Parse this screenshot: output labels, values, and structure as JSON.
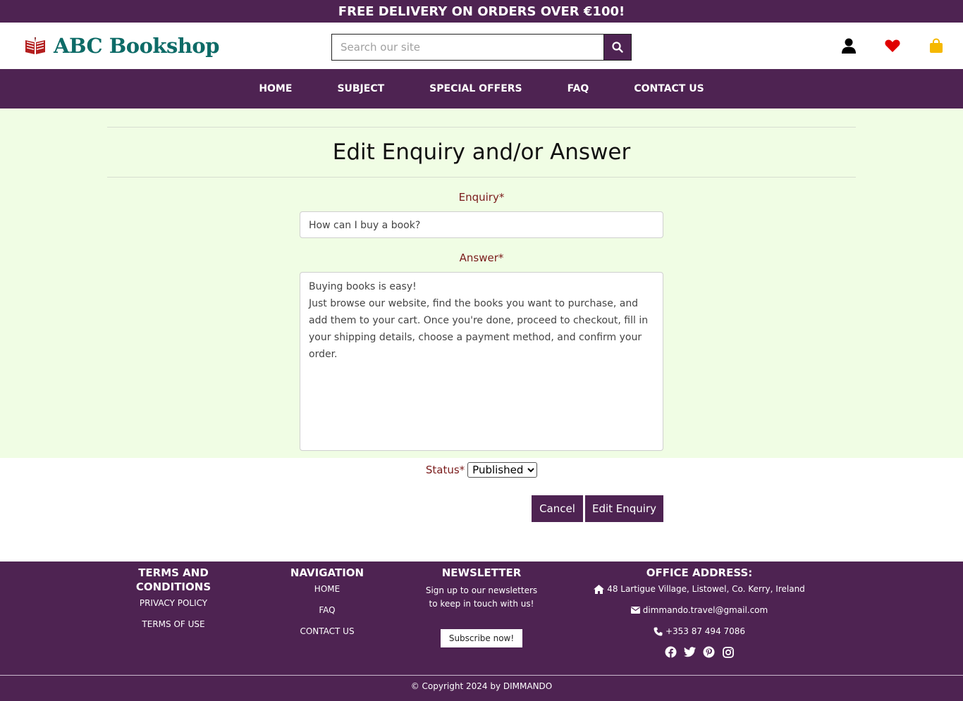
{
  "promo": "FREE DELIVERY ON ORDERS OVER €100!",
  "header": {
    "logo_text": "ABC Bookshop",
    "search_placeholder": "Search our site",
    "search_value": ""
  },
  "nav": {
    "items": [
      "HOME",
      "SUBJECT",
      "SPECIAL OFFERS",
      "FAQ",
      "CONTACT US"
    ]
  },
  "form": {
    "title": "Edit Enquiry and/or Answer",
    "enquiry_label": "Enquiry*",
    "enquiry_value": "How can I buy a book?",
    "answer_label": "Answer*",
    "answer_value": "Buying books is easy!\nJust browse our website, find the books you want to purchase, and add them to your cart. Once you're done, proceed to checkout, fill in your shipping details, choose a payment method, and confirm your order.",
    "status_label": "Status*",
    "status_value": "Published",
    "cancel_label": "Cancel",
    "submit_label": "Edit Enquiry"
  },
  "footer": {
    "terms": {
      "heading": "TERMS AND CONDITIONS",
      "links": [
        "PRIVACY POLICY",
        "TERMS OF USE"
      ]
    },
    "navigation": {
      "heading": "NAVIGATION",
      "links": [
        "HOME",
        "FAQ",
        "CONTACT US"
      ]
    },
    "newsletter": {
      "heading": "NEWSLETTER",
      "text_line1": "Sign up to our newsletters",
      "text_line2": "to keep in touch with us!",
      "button": "Subscribe now!"
    },
    "office": {
      "heading": "OFFICE ADDRESS:",
      "address": "48 Lartigue Village, Listowel, Co. Kerry, Ireland",
      "email": "dimmando.travel@gmail.com",
      "phone": "+353 87 494 7086"
    },
    "copyright": "© Copyright 2024 by DIMMANDO"
  },
  "colors": {
    "brand": "#4e2352",
    "logo_text": "#0d6b67",
    "form_bg": "#f0fde4",
    "label": "#7a1b1b",
    "heart": "#e00000",
    "bag": "#f5b800"
  },
  "icons": [
    "book-logo-icon",
    "search-icon",
    "user-icon",
    "heart-icon",
    "shopping-bag-icon",
    "home-icon",
    "envelope-icon",
    "phone-icon",
    "facebook-icon",
    "twitter-icon",
    "pinterest-icon",
    "instagram-icon"
  ]
}
